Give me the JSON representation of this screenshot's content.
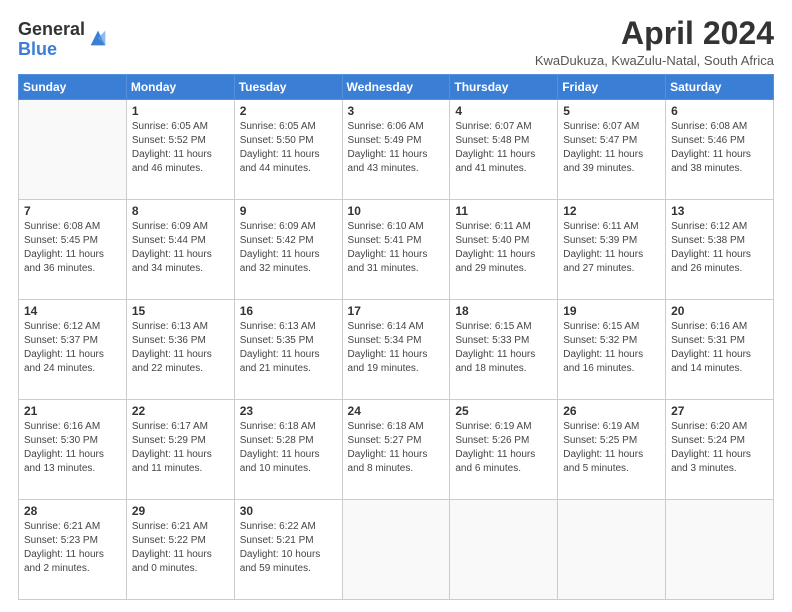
{
  "logo": {
    "general": "General",
    "blue": "Blue"
  },
  "title": "April 2024",
  "subtitle": "KwaDukuza, KwaZulu-Natal, South Africa",
  "days_of_week": [
    "Sunday",
    "Monday",
    "Tuesday",
    "Wednesday",
    "Thursday",
    "Friday",
    "Saturday"
  ],
  "weeks": [
    [
      {
        "day": "",
        "info": ""
      },
      {
        "day": "1",
        "info": "Sunrise: 6:05 AM\nSunset: 5:52 PM\nDaylight: 11 hours\nand 46 minutes."
      },
      {
        "day": "2",
        "info": "Sunrise: 6:05 AM\nSunset: 5:50 PM\nDaylight: 11 hours\nand 44 minutes."
      },
      {
        "day": "3",
        "info": "Sunrise: 6:06 AM\nSunset: 5:49 PM\nDaylight: 11 hours\nand 43 minutes."
      },
      {
        "day": "4",
        "info": "Sunrise: 6:07 AM\nSunset: 5:48 PM\nDaylight: 11 hours\nand 41 minutes."
      },
      {
        "day": "5",
        "info": "Sunrise: 6:07 AM\nSunset: 5:47 PM\nDaylight: 11 hours\nand 39 minutes."
      },
      {
        "day": "6",
        "info": "Sunrise: 6:08 AM\nSunset: 5:46 PM\nDaylight: 11 hours\nand 38 minutes."
      }
    ],
    [
      {
        "day": "7",
        "info": "Sunrise: 6:08 AM\nSunset: 5:45 PM\nDaylight: 11 hours\nand 36 minutes."
      },
      {
        "day": "8",
        "info": "Sunrise: 6:09 AM\nSunset: 5:44 PM\nDaylight: 11 hours\nand 34 minutes."
      },
      {
        "day": "9",
        "info": "Sunrise: 6:09 AM\nSunset: 5:42 PM\nDaylight: 11 hours\nand 32 minutes."
      },
      {
        "day": "10",
        "info": "Sunrise: 6:10 AM\nSunset: 5:41 PM\nDaylight: 11 hours\nand 31 minutes."
      },
      {
        "day": "11",
        "info": "Sunrise: 6:11 AM\nSunset: 5:40 PM\nDaylight: 11 hours\nand 29 minutes."
      },
      {
        "day": "12",
        "info": "Sunrise: 6:11 AM\nSunset: 5:39 PM\nDaylight: 11 hours\nand 27 minutes."
      },
      {
        "day": "13",
        "info": "Sunrise: 6:12 AM\nSunset: 5:38 PM\nDaylight: 11 hours\nand 26 minutes."
      }
    ],
    [
      {
        "day": "14",
        "info": "Sunrise: 6:12 AM\nSunset: 5:37 PM\nDaylight: 11 hours\nand 24 minutes."
      },
      {
        "day": "15",
        "info": "Sunrise: 6:13 AM\nSunset: 5:36 PM\nDaylight: 11 hours\nand 22 minutes."
      },
      {
        "day": "16",
        "info": "Sunrise: 6:13 AM\nSunset: 5:35 PM\nDaylight: 11 hours\nand 21 minutes."
      },
      {
        "day": "17",
        "info": "Sunrise: 6:14 AM\nSunset: 5:34 PM\nDaylight: 11 hours\nand 19 minutes."
      },
      {
        "day": "18",
        "info": "Sunrise: 6:15 AM\nSunset: 5:33 PM\nDaylight: 11 hours\nand 18 minutes."
      },
      {
        "day": "19",
        "info": "Sunrise: 6:15 AM\nSunset: 5:32 PM\nDaylight: 11 hours\nand 16 minutes."
      },
      {
        "day": "20",
        "info": "Sunrise: 6:16 AM\nSunset: 5:31 PM\nDaylight: 11 hours\nand 14 minutes."
      }
    ],
    [
      {
        "day": "21",
        "info": "Sunrise: 6:16 AM\nSunset: 5:30 PM\nDaylight: 11 hours\nand 13 minutes."
      },
      {
        "day": "22",
        "info": "Sunrise: 6:17 AM\nSunset: 5:29 PM\nDaylight: 11 hours\nand 11 minutes."
      },
      {
        "day": "23",
        "info": "Sunrise: 6:18 AM\nSunset: 5:28 PM\nDaylight: 11 hours\nand 10 minutes."
      },
      {
        "day": "24",
        "info": "Sunrise: 6:18 AM\nSunset: 5:27 PM\nDaylight: 11 hours\nand 8 minutes."
      },
      {
        "day": "25",
        "info": "Sunrise: 6:19 AM\nSunset: 5:26 PM\nDaylight: 11 hours\nand 6 minutes."
      },
      {
        "day": "26",
        "info": "Sunrise: 6:19 AM\nSunset: 5:25 PM\nDaylight: 11 hours\nand 5 minutes."
      },
      {
        "day": "27",
        "info": "Sunrise: 6:20 AM\nSunset: 5:24 PM\nDaylight: 11 hours\nand 3 minutes."
      }
    ],
    [
      {
        "day": "28",
        "info": "Sunrise: 6:21 AM\nSunset: 5:23 PM\nDaylight: 11 hours\nand 2 minutes."
      },
      {
        "day": "29",
        "info": "Sunrise: 6:21 AM\nSunset: 5:22 PM\nDaylight: 11 hours\nand 0 minutes."
      },
      {
        "day": "30",
        "info": "Sunrise: 6:22 AM\nSunset: 5:21 PM\nDaylight: 10 hours\nand 59 minutes."
      },
      {
        "day": "",
        "info": ""
      },
      {
        "day": "",
        "info": ""
      },
      {
        "day": "",
        "info": ""
      },
      {
        "day": "",
        "info": ""
      }
    ]
  ]
}
